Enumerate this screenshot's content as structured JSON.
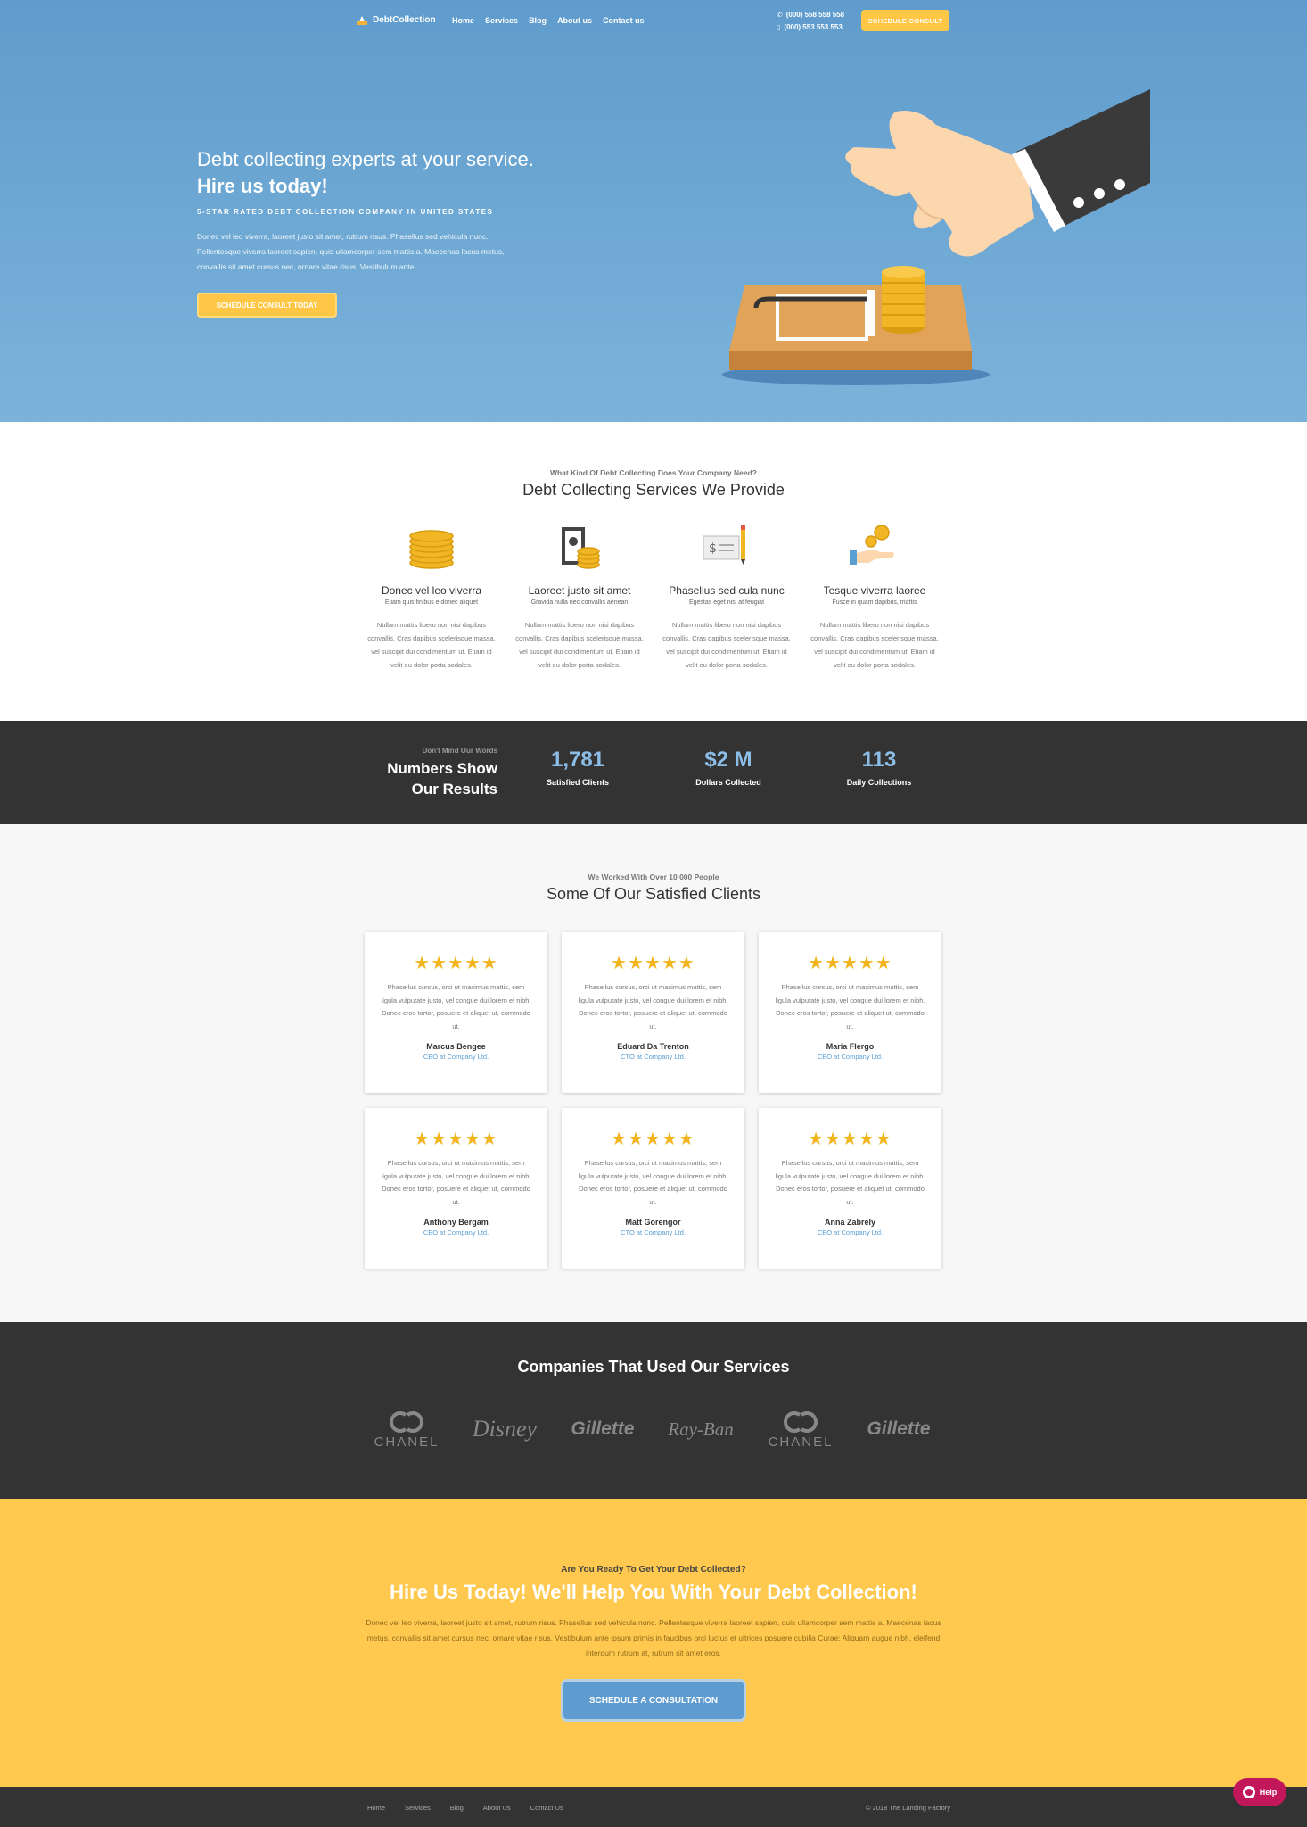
{
  "nav": {
    "logo": "DebtCollection",
    "links": [
      "Home",
      "Services",
      "Blog",
      "About us",
      "Contact us"
    ],
    "phones": [
      "(000) 558 558 558",
      "(000) 553 553 553"
    ],
    "cta": "Schedule Consult"
  },
  "hero": {
    "title_plain": "Debt collecting experts at your service. ",
    "title_bold": "Hire us today!",
    "subtitle": "5-star rated debt collection company in United States",
    "text": "Donec vel leo viverra, laoreet justo sit amet, rutrum risus. Phasellus sed vehicula nunc. Pellentesque viverra laoreet sapien, quis ullamcorper sem mattis a. Maecenas lacus metus, convallis sit amet cursus nec, ornare vitae risus. Vestibulum ante.",
    "button": "Schedule Consult Today"
  },
  "services": {
    "eyebrow": "What Kind Of Debt Collecting Does Your Company Need?",
    "title": "Debt Collecting Services We Provide",
    "items": [
      {
        "title": "Donec vel leo viverra",
        "tag": "Etiam quis finibus e donec aliquet",
        "text": "Nullam mattis libero non nisi dapibus convallis. Cras dapibus scelerisque massa, vel suscipit dui condimentum ut. Etiam id velit eu dolor porta sodales.",
        "icon": "coins-stack-icon"
      },
      {
        "title": "Laoreet justo sit amet",
        "tag": "Gravida nulla nec convallis aenean",
        "text": "Nullam mattis libero non nisi dapibus convallis. Cras dapibus scelerisque massa, vel suscipit dui condimentum ut. Etiam id velit eu dolor porta sodales.",
        "icon": "cash-and-coins-icon"
      },
      {
        "title": "Phasellus sed cula nunc",
        "tag": "Egestas eget nisi at feugiat",
        "text": "Nullam mattis libero non nisi dapibus convallis. Cras dapibus scelerisque massa, vel suscipit dui condimentum ut. Etiam id velit eu dolor porta sodales.",
        "icon": "check-and-pen-icon"
      },
      {
        "title": "Tesque viverra laoree",
        "tag": "Fusce in quam dapibus, mattis",
        "text": "Nullam mattis libero non nisi dapibus convallis. Cras dapibus scelerisque massa, vel suscipit dui condimentum ut. Etiam id velit eu dolor porta sodales.",
        "icon": "hand-with-coins-icon"
      }
    ]
  },
  "stats": {
    "eyebrow": "Don't Mind Our Words",
    "title_line1": "Numbers Show",
    "title_line2": "Our Results",
    "items": [
      {
        "value": "1,781",
        "label": "Satisfied Clients"
      },
      {
        "value": "$2 M",
        "label": "Dollars Collected"
      },
      {
        "value": "113",
        "label": "Daily Collections"
      }
    ]
  },
  "testimonials": {
    "eyebrow": "We Worked With Over 10 000 People",
    "title": "Some Of Our Satisfied Clients",
    "stars": "★★★★★",
    "items": [
      {
        "text": "Phasellus cursus, orci ut maximus mattis, sem ligula vulputate justo, vel congue dui lorem et nibh. Donec eros tortor, posuere et aliquet ut, commodo ut.",
        "name": "Marcus Bengee",
        "role": "CEO at Company Ltd."
      },
      {
        "text": "Phasellus cursus, orci ut maximus mattis, sem ligula vulputate justo, vel congue dui lorem et nibh. Donec eros tortor, posuere et aliquet ut, commodo ut.",
        "name": "Eduard Da Trenton",
        "role": "CTO at Company Ltd."
      },
      {
        "text": "Phasellus cursus, orci ut maximus mattis, sem ligula vulputate justo, vel congue dui lorem et nibh. Donec eros tortor, posuere et aliquet ut, commodo ut.",
        "name": "Maria Flergo",
        "role": "CEO at Company Ltd."
      },
      {
        "text": "Phasellus cursus, orci ut maximus mattis, sem ligula vulputate justo, vel congue dui lorem et nibh. Donec eros tortor, posuere et aliquet ut, commodo ut.",
        "name": "Anthony Bergam",
        "role": "CEO at Company Ltd."
      },
      {
        "text": "Phasellus cursus, orci ut maximus mattis, sem ligula vulputate justo, vel congue dui lorem et nibh. Donec eros tortor, posuere et aliquet ut, commodo ut.",
        "name": "Matt Gorengor",
        "role": "CTO at Company Ltd."
      },
      {
        "text": "Phasellus cursus, orci ut maximus mattis, sem ligula vulputate justo, vel congue dui lorem et nibh. Donec eros tortor, posuere et aliquet ut, commodo ut.",
        "name": "Anna Zabrely",
        "role": "CEO at Company Ltd."
      }
    ]
  },
  "companies": {
    "title": "Companies That Used Our Services",
    "brands": [
      "CHANEL",
      "Disney",
      "Gillette",
      "Ray-Ban",
      "CHANEL",
      "Gillette"
    ]
  },
  "cta": {
    "eyebrow": "Are You Ready To Get Your Debt Collected?",
    "title": "Hire Us Today! We'll Help You With Your Debt Collection!",
    "text": "Donec vel leo viverra, laoreet justo sit amet, rutrum risus. Phasellus sed vehicula nunc. Pellentesque viverra laoreet sapien, quis ullamcorper sem mattis a. Maecenas lacus metus, convallis sit amet cursus nec, ornare vitae risus. Vestibulum ante ipsum primis in faucibus orci luctus et ultrices posuere cubilia Curae; Aliquam augue nibh, eleifend interdum rutrum at, rutrum sit amet eros.",
    "button": "Schedule A Consultation"
  },
  "footer": {
    "links": [
      "Home",
      "Services",
      "Blog",
      "About Us",
      "Contact Us"
    ],
    "copyright": "© 2018 The Landing Factory"
  },
  "help": {
    "label": "Help"
  },
  "colors": {
    "accent_yellow": "#ffc745",
    "hero_blue": "#5f9ccd",
    "dark": "#333333",
    "link_blue": "#5a9fd4",
    "star": "#f3b51d"
  }
}
